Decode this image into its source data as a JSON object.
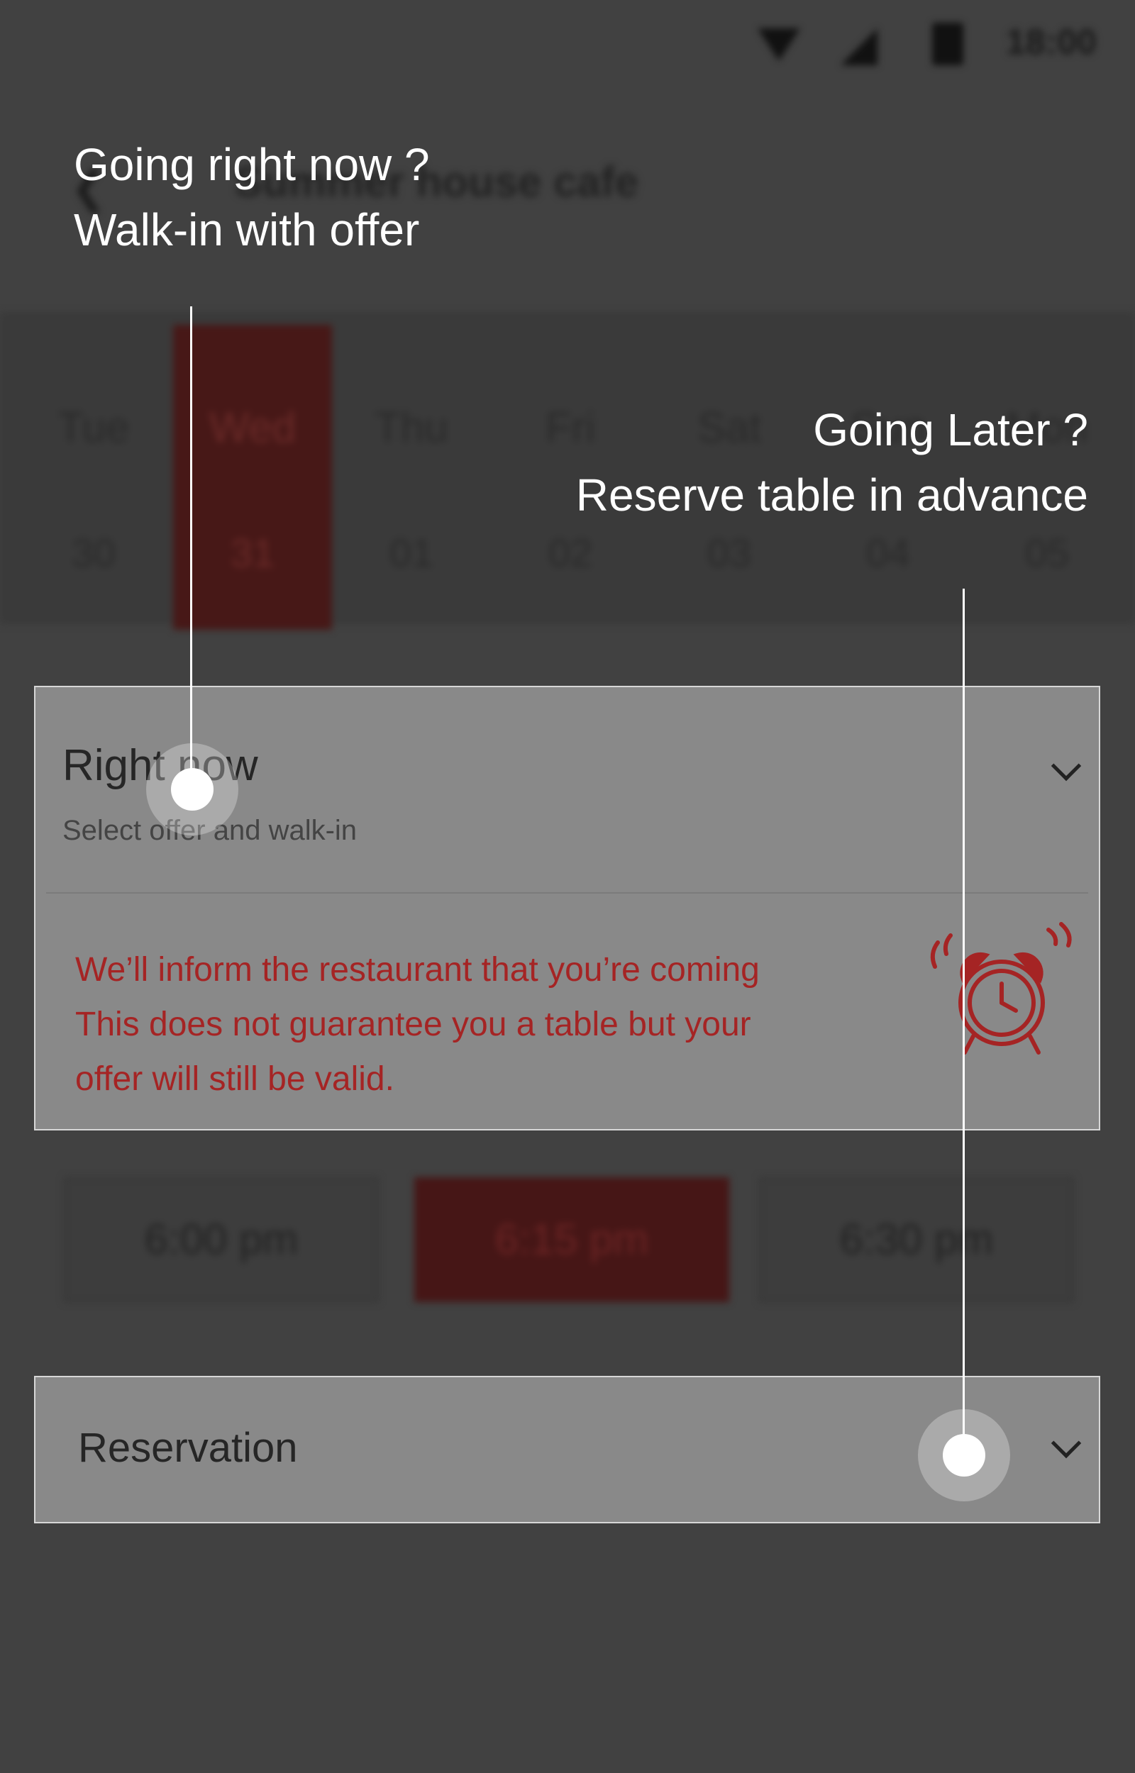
{
  "status_bar": {
    "time": "18:00",
    "icons": [
      "wifi-icon",
      "cellular-signal-icon",
      "battery-icon"
    ]
  },
  "app_bar": {
    "back_icon": "back-arrow-icon",
    "title": "Summer house cafe"
  },
  "date_picker": {
    "days": [
      {
        "dow": "Tue",
        "day": "30",
        "selected": false
      },
      {
        "dow": "Wed",
        "day": "31",
        "selected": true
      },
      {
        "dow": "Thu",
        "day": "01",
        "selected": false
      },
      {
        "dow": "Fri",
        "day": "02",
        "selected": false
      },
      {
        "dow": "Sat",
        "day": "03",
        "selected": false
      },
      {
        "dow": "Sun",
        "day": "04",
        "selected": false
      },
      {
        "dow": "Mon",
        "day": "05",
        "selected": false
      }
    ]
  },
  "right_now_panel": {
    "title": "Right now",
    "subtitle": "Select offer and walk-in",
    "expand_icon": "chevron-down-icon",
    "notice_lines": [
      "We’ll inform the restaurant that you’re coming",
      "This does not guarantee you a table but your",
      "offer will still be valid."
    ],
    "illustration_icon": "alarm-clock-icon"
  },
  "time_slots": [
    {
      "label": "6:00 pm",
      "selected": false
    },
    {
      "label": "6:15 pm",
      "selected": true
    },
    {
      "label": "6:30 pm",
      "selected": false
    }
  ],
  "reservation_panel": {
    "title": "Reservation",
    "expand_icon": "chevron-down-icon"
  },
  "hints": {
    "walk_in": {
      "line1": "Going right now ?",
      "line2": "Walk-in with offer"
    },
    "reserve": {
      "line1": "Going Later ?",
      "line2": "Reserve table in advance"
    }
  },
  "colors": {
    "overlay_bg": "#414141",
    "panel_bg": "#898989",
    "accent_red": "#a52424",
    "selected_red": "#471817",
    "hint_text": "#ffffff"
  }
}
